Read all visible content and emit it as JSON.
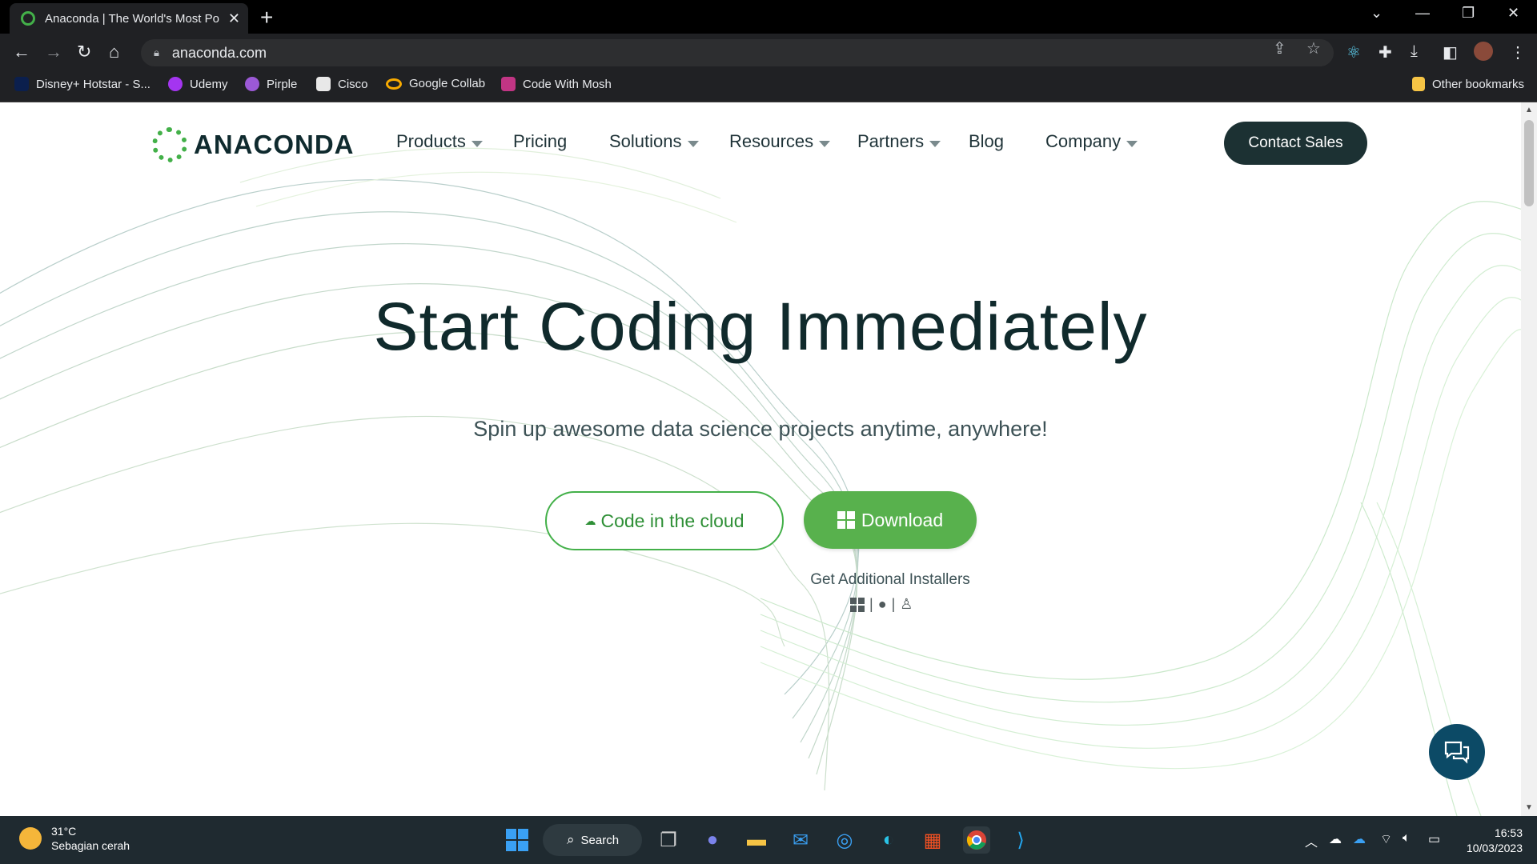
{
  "browser": {
    "tab_title": "Anaconda | The World's Most Po",
    "url": "anaconda.com",
    "bookmarks": [
      "Disney+ Hotstar - S...",
      "Udemy",
      "Pirple",
      "Cisco",
      "Google Collab",
      "Code With Mosh"
    ],
    "other_bookmarks": "Other bookmarks"
  },
  "site": {
    "logo_text": "ANACONDA",
    "nav": [
      "Products",
      "Pricing",
      "Solutions",
      "Resources",
      "Partners",
      "Blog",
      "Company"
    ],
    "contact_label": "Contact Sales",
    "hero_title": "Start Coding Immediately",
    "hero_subtitle": "Spin up awesome data science projects anytime, anywhere!",
    "cloud_label": "Code in the cloud",
    "download_label": "Download",
    "installers_label": "Get Additional Installers"
  },
  "taskbar": {
    "temp": "31°C",
    "weather": "Sebagian cerah",
    "search_label": "Search",
    "time": "16:53",
    "date": "10/03/2023"
  },
  "colors": {
    "brand_green": "#43b049",
    "download_green": "#58b14d",
    "contact_dark": "#1c3133",
    "chat_blue": "#0c4a66"
  }
}
